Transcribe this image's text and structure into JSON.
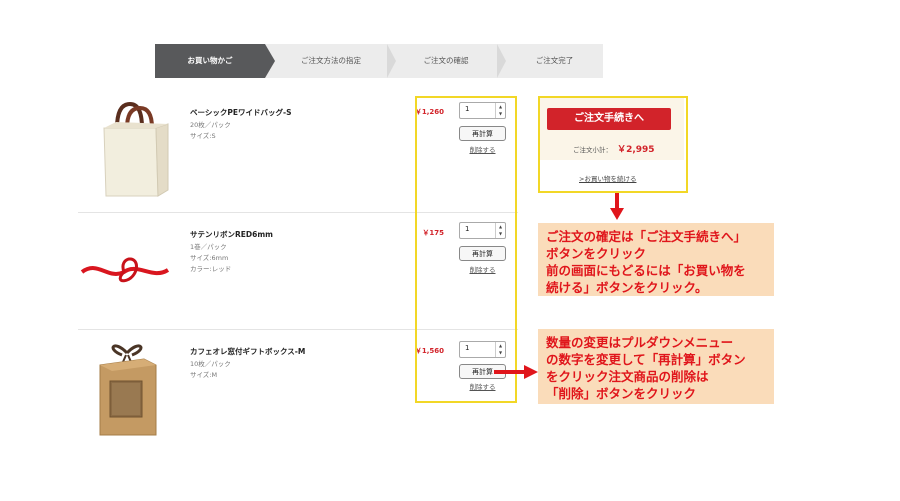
{
  "steps": [
    {
      "label": "お買い物かご",
      "active": true
    },
    {
      "label": "ご注文方法の指定",
      "active": false
    },
    {
      "label": "ご注文の確認",
      "active": false
    },
    {
      "label": "ご注文完了",
      "active": false
    }
  ],
  "cart": {
    "items": [
      {
        "name": "ベーシックPEワイドバッグ-S",
        "specs": [
          "20枚／パック",
          "サイズ:S"
        ],
        "price": "￥1,260",
        "quantity": "1",
        "recalc_label": "再計算",
        "delete_label": "削除する"
      },
      {
        "name": "サテンリボンRED6mm",
        "specs": [
          "1巻／パック",
          "サイズ:6mm",
          "カラー:レッド"
        ],
        "price": "￥175",
        "quantity": "1",
        "recalc_label": "再計算",
        "delete_label": "削除する"
      },
      {
        "name": "カフェオレ窓付ギフトボックス-M",
        "specs": [
          "10枚／パック",
          "サイズ:M"
        ],
        "price": "￥1,560",
        "quantity": "1",
        "recalc_label": "再計算",
        "delete_label": "削除する"
      }
    ]
  },
  "summary": {
    "checkout_label": "ご注文手続きへ",
    "subtotal_label": "ご注文小計：",
    "subtotal_value": "￥2,995",
    "continue_label": ">お買い物を続ける"
  },
  "callouts": {
    "checkout_lines": [
      "ご注文の確定は「ご注文手続きへ」",
      "ボタンをクリック",
      "前の画面にもどるには「お買い物を",
      "続ける」ボタンをクリック。"
    ],
    "quantity_lines": [
      "数量の変更はプルダウンメニュー",
      "の数字を変更して「再計算」ボタン",
      "をクリック注文商品の削除は",
      "「削除」ボタンをクリック"
    ]
  },
  "colors": {
    "accent_red": "#d2232a",
    "frame_yellow": "#f2d726",
    "callout_bg": "#fadcba"
  }
}
